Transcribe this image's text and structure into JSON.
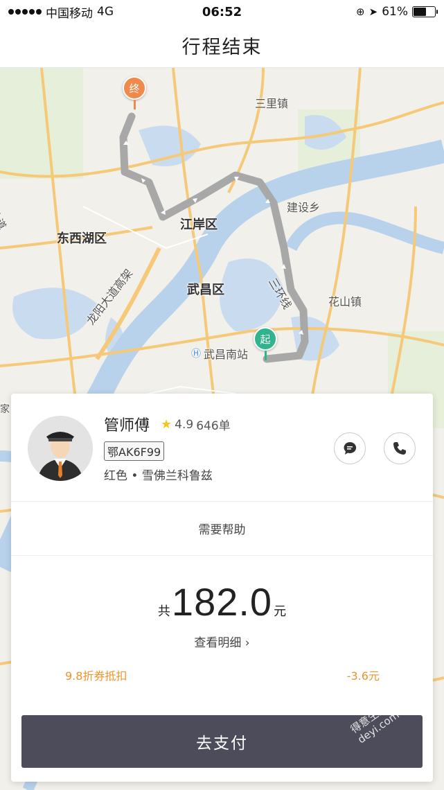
{
  "status_bar": {
    "carrier": "中国移动",
    "network": "4G",
    "time": "06:52",
    "battery": "61%",
    "battery_level": 0.61
  },
  "nav": {
    "title": "行程结束"
  },
  "map": {
    "labels": {
      "sanli": "三里镇",
      "jianshe": "建设乡",
      "dongxihu": "东西湖区",
      "jiangan": "江岸区",
      "wuchang": "武昌区",
      "huashan": "花山镇",
      "longyang": "龙阳大道高架",
      "sanhuan": "三环线",
      "station": "武昌南站",
      "left_edge_a": "大道",
      "left_edge_b": "家"
    },
    "end_marker": "终",
    "start_marker": "起"
  },
  "driver": {
    "name": "管师傅",
    "rating": "4.9",
    "orders": "646单",
    "plate": "鄂AK6F99",
    "car": "红色 • 雪佛兰科鲁兹"
  },
  "help": {
    "label": "需要帮助"
  },
  "fare": {
    "prefix": "共",
    "amount": "182.0",
    "unit": "元",
    "detail_link": "查看明细 ›",
    "coupon_label": "9.8折券抵扣",
    "coupon_value": "-3.6元"
  },
  "pay_button": {
    "label": "去支付"
  },
  "watermark": {
    "line1": "得意生活",
    "line2": "deyi.com"
  },
  "colors": {
    "accent_orange": "#f0932b",
    "end_pin": "#f08a4b",
    "start_pin": "#2fb48e",
    "pay_button": "#4d4c5a",
    "route": "#a8a8a8"
  }
}
